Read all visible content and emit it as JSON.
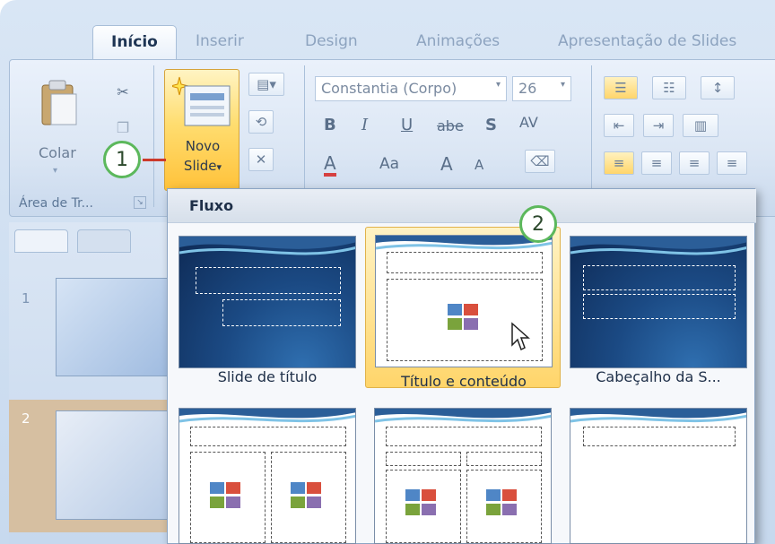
{
  "tabs": [
    {
      "label": "Início",
      "active": true
    },
    {
      "label": "Inserir",
      "active": false
    },
    {
      "label": "Design",
      "active": false
    },
    {
      "label": "Animações",
      "active": false
    },
    {
      "label": "Apresentação de Slides",
      "active": false
    }
  ],
  "clipboard": {
    "paste_label": "Colar",
    "group_label": "Área de Tr..."
  },
  "slides": {
    "new_slide_line1": "Novo",
    "new_slide_line2": "Slide",
    "new_slide_arrow": "▾"
  },
  "font": {
    "name": "Constantia (Corpo)",
    "size": "26",
    "bold": "B",
    "italic": "I",
    "underline": "U",
    "strike": "abe",
    "shadow": "S",
    "spacing": "AV",
    "color": "A",
    "case": "Aa",
    "grow": "A",
    "shrink": "A"
  },
  "callouts": {
    "one": "1",
    "two": "2"
  },
  "thumbnails": [
    {
      "number": "1"
    },
    {
      "number": "2"
    }
  ],
  "gallery": {
    "header": "Fluxo",
    "layouts": [
      {
        "label": "Slide de título",
        "selected": false
      },
      {
        "label": "Título e conteúdo",
        "selected": true
      },
      {
        "label": "Cabeçalho da S...",
        "selected": false
      }
    ]
  },
  "colors": {
    "accent_selected": "#ffd56a",
    "callout_border": "#5cb85c",
    "theme_dark": "#1b4a84"
  }
}
